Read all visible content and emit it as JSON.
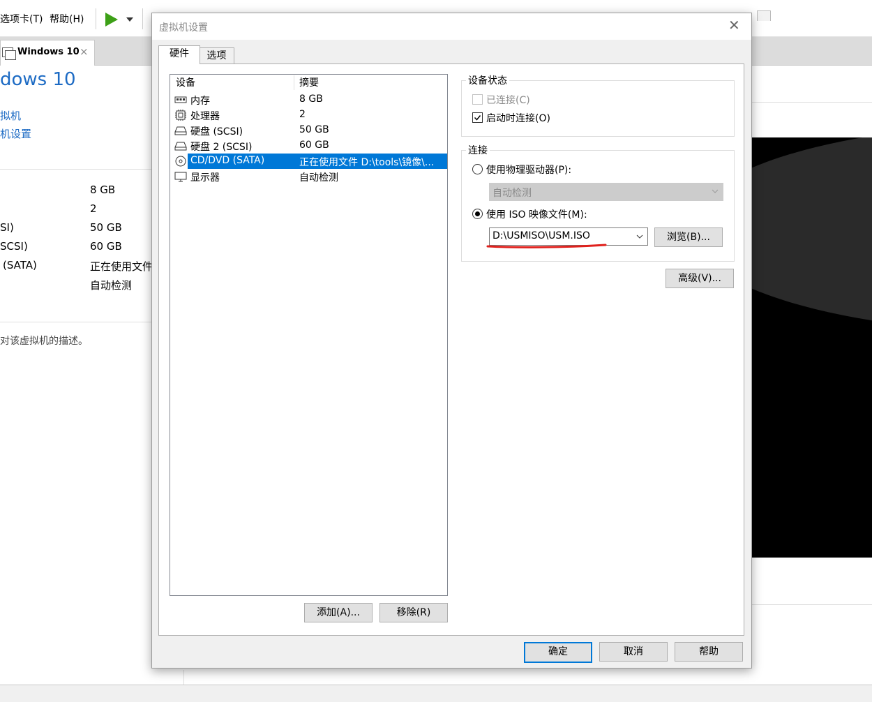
{
  "app": {
    "menu": [
      "选项卡(T)",
      "帮助(H)"
    ],
    "tab_title": "Windows 10",
    "tab_close": "×",
    "vm_title": "dows 10",
    "commands": [
      "拟机",
      "机设置"
    ],
    "devices_summary": [
      {
        "name": "",
        "value": "8 GB"
      },
      {
        "name": "",
        "value": "2"
      },
      {
        "name": "SI)",
        "value": "50 GB"
      },
      {
        "name": "SCSI)",
        "value": "60 GB"
      },
      {
        "name": "(SATA)",
        "value": "正在使用文件"
      },
      {
        "name": "",
        "value": "自动检测"
      }
    ],
    "description": "对该虚拟机的描述。"
  },
  "dialog": {
    "title": "虚拟机设置",
    "close": "✕",
    "tabs": [
      "硬件",
      "选项"
    ],
    "list": {
      "col_device": "设备",
      "col_summary": "摘要",
      "rows": [
        {
          "device": "内存",
          "summary": "8 GB",
          "icon": "memory-icon"
        },
        {
          "device": "处理器",
          "summary": "2",
          "icon": "cpu-icon"
        },
        {
          "device": "硬盘 (SCSI)",
          "summary": "50 GB",
          "icon": "harddisk-icon"
        },
        {
          "device": "硬盘 2 (SCSI)",
          "summary": "60 GB",
          "icon": "harddisk-icon"
        },
        {
          "device": "CD/DVD (SATA)",
          "summary": "正在使用文件 D:\\tools\\镜像\\...",
          "icon": "cd-icon",
          "selected": true
        },
        {
          "device": "显示器",
          "summary": "自动检测",
          "icon": "monitor-icon"
        }
      ]
    },
    "add_button": "添加(A)...",
    "remove_button": "移除(R)",
    "device_status": {
      "title": "设备状态",
      "connected": "已连接(C)",
      "connect_at_power_on": "启动时连接(O)",
      "connected_checked": false,
      "connect_at_power_on_checked": true
    },
    "connection": {
      "title": "连接",
      "physical_drive": "使用物理驱动器(P):",
      "physical_select": "自动检测",
      "iso_image": "使用 ISO 映像文件(M):",
      "iso_path": "D:\\USMISO\\USM.ISO",
      "browse": "浏览(B)...",
      "selected": "iso"
    },
    "advanced_button": "高级(V)...",
    "ok_button": "确定",
    "cancel_button": "取消",
    "help_button": "帮助"
  },
  "colors": {
    "accent": "#0078d7",
    "link": "#1d6bc4",
    "annotation": "#e0201c",
    "play": "#3da017"
  }
}
